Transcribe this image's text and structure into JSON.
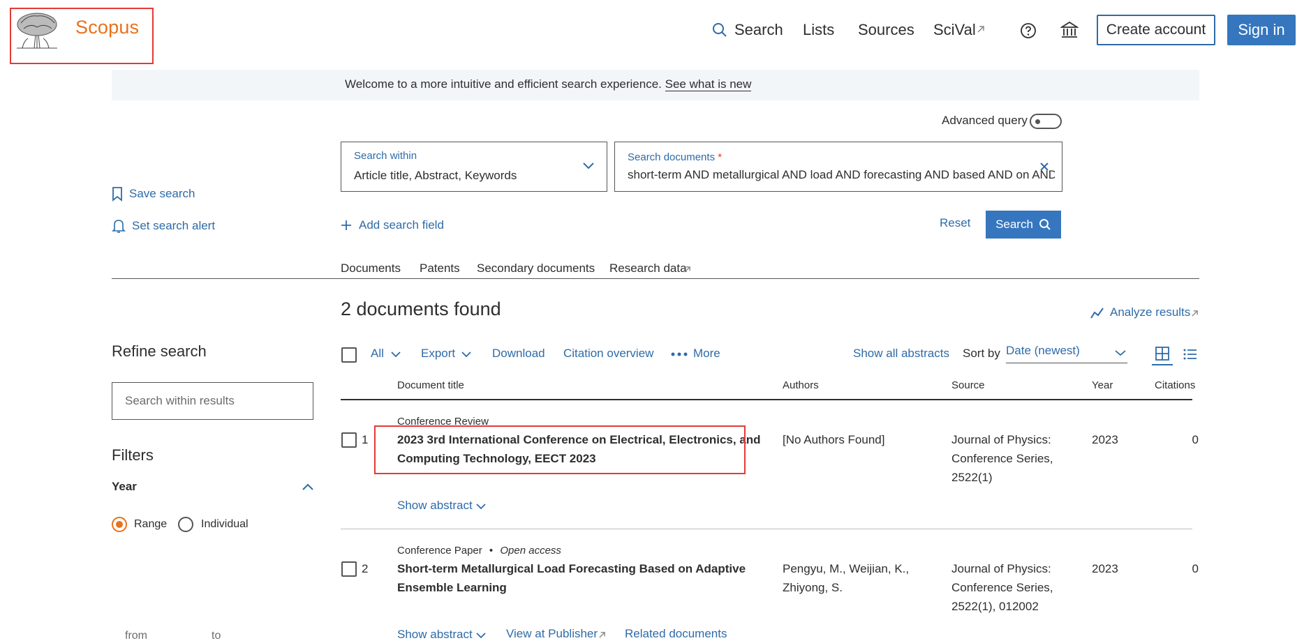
{
  "header": {
    "logo_text": "Scopus",
    "nav": [
      "Search",
      "Lists",
      "Sources",
      "SciVal"
    ],
    "create_account": "Create account",
    "sign_in": "Sign in"
  },
  "banner": {
    "text": "Welcome to a more intuitive and efficient search experience.",
    "link": "See what is new"
  },
  "search": {
    "advanced_query_label": "Advanced query",
    "within_label": "Search within",
    "within_value": "Article title, Abstract, Keywords",
    "docs_label": "Search documents",
    "required_mark": "*",
    "docs_value": "short-term AND metallurgical AND load AND forecasting AND based AND on AND",
    "add_field": "Add search field",
    "reset": "Reset",
    "search_button": "Search"
  },
  "sidebar_actions": {
    "save_search": "Save search",
    "set_alert": "Set search alert"
  },
  "tabs": [
    "Documents",
    "Patents",
    "Secondary documents",
    "Research data"
  ],
  "results": {
    "found": "2 documents found",
    "analyze": "Analyze results"
  },
  "refine": {
    "title": "Refine search",
    "within_placeholder": "Search within results",
    "filters": "Filters",
    "year": "Year",
    "range": "Range",
    "individual": "Individual",
    "from": "from",
    "to": "to"
  },
  "toolbar": {
    "all": "All",
    "export": "Export",
    "download": "Download",
    "citation_overview": "Citation overview",
    "more": "More",
    "show_all_abstracts": "Show all abstracts",
    "sort_by": "Sort by",
    "sort_value": "Date (newest)"
  },
  "columns": {
    "title": "Document title",
    "authors": "Authors",
    "source": "Source",
    "year": "Year",
    "citations": "Citations"
  },
  "rows": [
    {
      "num": "1",
      "type": "Conference Review",
      "access": "",
      "title_1": "2023 3rd International Conference on Electrical, Electronics, and",
      "title_2": "Computing Technology, EECT 2023",
      "authors_1": "[No Authors Found]",
      "authors_2": "",
      "source_1": "Journal of Physics:",
      "source_2": "Conference Series,",
      "source_3": "2522(1)",
      "year": "2023",
      "citations": "0",
      "show_abstract": "Show abstract"
    },
    {
      "num": "2",
      "type": "Conference Paper",
      "access": "Open access",
      "title_1": "Short-term Metallurgical Load Forecasting Based on Adaptive",
      "title_2": "Ensemble Learning",
      "authors_1": "Pengyu, M., Weijian, K.,",
      "authors_2": "Zhiyong, S.",
      "source_1": "Journal of Physics:",
      "source_2": "Conference Series,",
      "source_3": "2522(1), 012002",
      "year": "2023",
      "citations": "0",
      "show_abstract": "Show abstract",
      "view_publisher": "View at Publisher",
      "related": "Related documents"
    }
  ],
  "colors": {
    "brand_orange": "#e9711c",
    "link_blue": "#2e6ba8",
    "button_blue": "#3576bf",
    "highlight_red": "#e53935"
  }
}
